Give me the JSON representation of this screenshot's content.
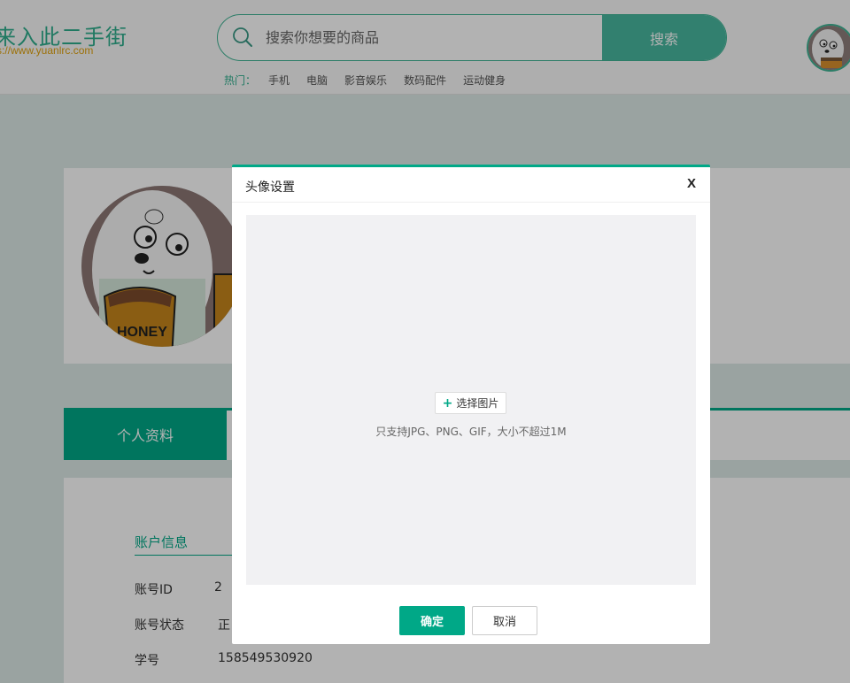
{
  "header": {
    "logo_title": "来入此二手街",
    "logo_url": "s://www.yuanlrc.com",
    "search_placeholder": "搜索你想要的商品",
    "search_button": "搜索",
    "hot_label": "热门：",
    "hot_items": [
      "手机",
      "电脑",
      "影音娱乐",
      "数码配件",
      "运动健身"
    ]
  },
  "profile": {
    "tabs": [
      "个人资料"
    ],
    "section_title": "账户信息",
    "rows": [
      {
        "label": "账号ID",
        "value": "2"
      },
      {
        "label": "账号状态",
        "value": "正"
      },
      {
        "label": "学号",
        "value": "158549530920"
      }
    ]
  },
  "modal": {
    "title": "头像设置",
    "close": "X",
    "choose_button": "选择图片",
    "hint": "只支持JPG、PNG、GIF，大小不超过1M",
    "confirm": "确定",
    "cancel": "取消"
  },
  "colors": {
    "accent": "#00a887",
    "search_button": "#48b8a0",
    "logo_url": "#e0a10b"
  },
  "icons": {
    "search": "search-icon",
    "plus": "plus-icon",
    "close": "close-icon"
  }
}
